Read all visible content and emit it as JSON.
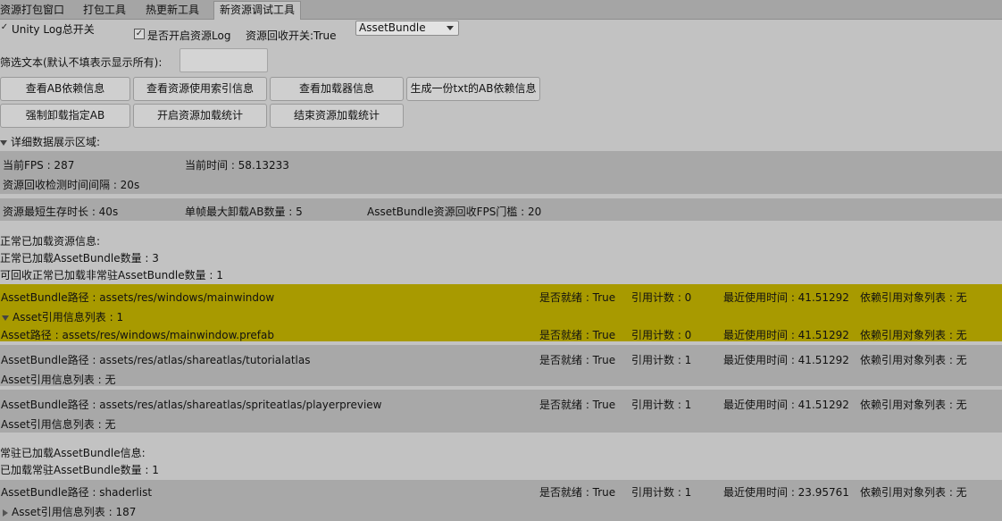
{
  "tabs": [
    "资源打包窗口",
    "打包工具",
    "热更新工具",
    "新资源调试工具"
  ],
  "toolbar": {
    "unity_log_label": "Unity Log总开关",
    "asset_log_label": "是否开启资源Log",
    "recycle_label": "资源回收开关:True",
    "dropdown_value": "AssetBundle"
  },
  "filter": {
    "label": "筛选文本(默认不填表示显示所有):",
    "value": ""
  },
  "buttons": {
    "view_ab_deps": "查看AB依赖信息",
    "view_asset_usage": "查看资源使用索引信息",
    "view_loader_info": "查看加载器信息",
    "export_txt": "生成一份txt的AB依赖信息",
    "force_unload": "强制卸载指定AB",
    "start_stats": "开启资源加载统计",
    "end_stats": "结束资源加载统计"
  },
  "detail_header": "详细数据展示区域:",
  "stats": {
    "fps": "当前FPS : 287",
    "time": "当前时间 : 58.13233",
    "interval": "资源回收检测时间间隔 : 20s",
    "min_life": "资源最短生存时长 : 40s",
    "max_unload": "单帧最大卸载AB数量 : 5",
    "fps_threshold": "AssetBundle资源回收FPS门槛 : 20"
  },
  "normal_section": {
    "title": "正常已加载资源信息:",
    "count": "正常已加载AssetBundle数量 : 3",
    "recyclable": "可回收正常已加载非常驻AssetBundle数量 : 1"
  },
  "bundles": [
    {
      "path": "AssetBundle路径 : assets/res/windows/mainwindow",
      "ready": "是否就绪 : True",
      "refcount": "引用计数 : 0",
      "last_used": "最近使用时间 : 41.51292",
      "deps": "依赖引用对象列表 : 无",
      "asset_list": "Asset引用信息列表 : 1",
      "asset": {
        "path": "Asset路径 : assets/res/windows/mainwindow.prefab",
        "ready": "是否就绪 : True",
        "refcount": "引用计数 : 0",
        "last_used": "最近使用时间 : 41.51292",
        "deps": "依赖引用对象列表 : 无"
      }
    },
    {
      "path": "AssetBundle路径 : assets/res/atlas/shareatlas/tutorialatlas",
      "ready": "是否就绪 : True",
      "refcount": "引用计数 : 1",
      "last_used": "最近使用时间 : 41.51292",
      "deps": "依赖引用对象列表 : 无",
      "asset_list": "Asset引用信息列表 : 无"
    },
    {
      "path": "AssetBundle路径 : assets/res/atlas/shareatlas/spriteatlas/playerpreview",
      "ready": "是否就绪 : True",
      "refcount": "引用计数 : 1",
      "last_used": "最近使用时间 : 41.51292",
      "deps": "依赖引用对象列表 : 无",
      "asset_list": "Asset引用信息列表 : 无"
    }
  ],
  "resident_section": {
    "title": "常驻已加载AssetBundle信息:",
    "count": "已加载常驻AssetBundle数量 : 1"
  },
  "resident_bundle": {
    "path": "AssetBundle路径 : shaderlist",
    "ready": "是否就绪 : True",
    "refcount": "引用计数 : 1",
    "last_used": "最近使用时间 : 23.95761",
    "deps": "依赖引用对象列表 : 无",
    "asset_list": "Asset引用信息列表 : 187"
  },
  "colors": {
    "panel_bg": "#c2c2c2",
    "highlight": "#a89a00",
    "band": "#a8a8a8"
  }
}
